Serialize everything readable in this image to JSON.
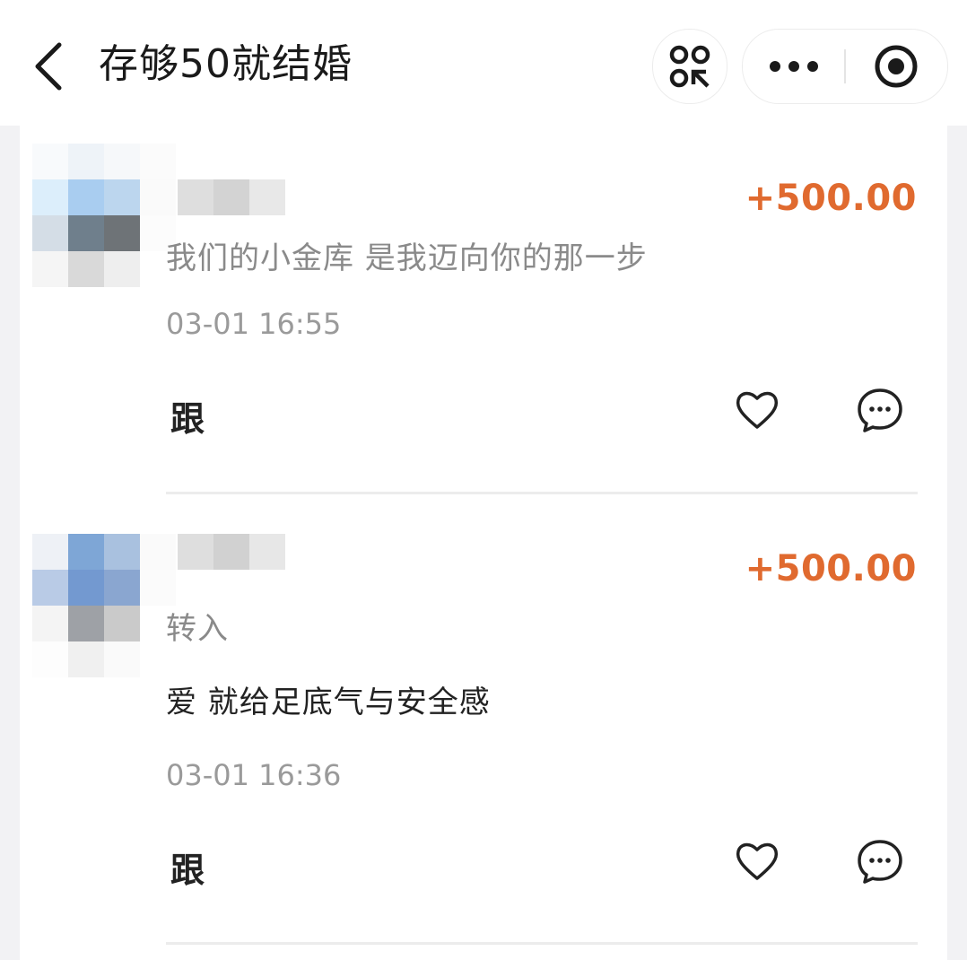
{
  "header": {
    "title": "存够50就结婚",
    "back_icon": "chevron-left-icon",
    "scan_icon": "scan-code-icon",
    "more_icon": "more-dots-icon",
    "close_icon": "target-close-icon"
  },
  "records": [
    {
      "amount": "+500.00",
      "subtext": "我们的小金库 是我迈向你的那一步",
      "message": "",
      "time": "03-01 16:55",
      "follow_label": "跟"
    },
    {
      "amount": "+500.00",
      "subtext": "转入",
      "message": "爱 就给足底气与安全感",
      "time": "03-01 16:36",
      "follow_label": "跟"
    }
  ],
  "colors": {
    "amount": "#e06a2f",
    "background": "#f2f2f4",
    "card": "#ffffff"
  }
}
